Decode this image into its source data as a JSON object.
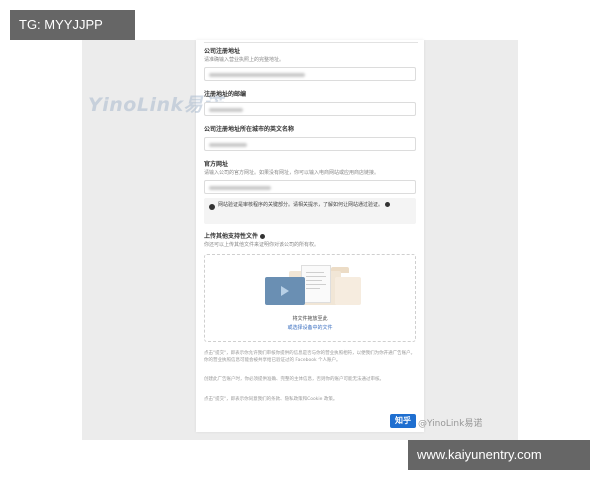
{
  "badges": {
    "top_left": "TG: MYYJJPP",
    "bottom_right": "www.kaiyunentry.com"
  },
  "watermark": {
    "logo": "YinoLink易诺",
    "zhihu": "@YinoLink易诺"
  },
  "form": {
    "address": {
      "label": "公司注册地址",
      "hint": "请准确输入营业执照上的完整地址。"
    },
    "postal": {
      "label": "注册地址的邮编"
    },
    "city_english": {
      "label": "公司注册地址所在城市的英文名称"
    },
    "website": {
      "label": "官方网址",
      "hint": "请输入公司的官方网址。如果没有网址，你可以输入电商网站或应用商店链接。"
    },
    "notice": {
      "text": "网站验证是审核程序的关键部分。请相关提示，了解如何让网站通过验证。"
    },
    "upload": {
      "label": "上传其他支持性文件",
      "hint": "你还可以上传其他文件来证明你对该公司的所有权。",
      "drop_text": "将文件拖放至此",
      "link_text": "或选择设备中的文件"
    },
    "footer": {
      "p1": "点击\"提交\"，即表示你允许我们审核你提供的信息是否与你的营业执照相符，以便我们为你开通广告账户。你的营业执照信息可能会被共享给已验证过的 Facebook 个人账户。",
      "p2": "创建此广告账户时，你必须提供准确、完整的主体信息，否则你的账户可能无法通过审核。",
      "p3": "点击\"提交\"，即表示你同意我们的条款、隐私政策和Cookie 政策。"
    },
    "submit_label": "知乎"
  },
  "colors": {
    "badge_bg": "#666666",
    "link_blue": "#3b6fc0",
    "button_blue": "#1f6fd0"
  }
}
